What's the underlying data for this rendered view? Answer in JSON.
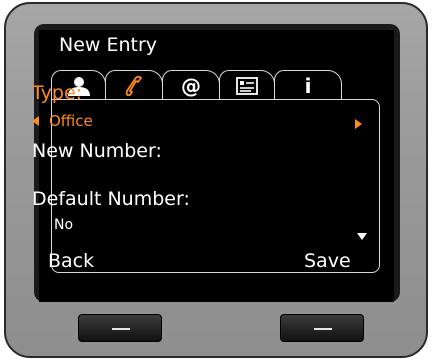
{
  "header": {
    "title": "New Entry"
  },
  "tabs": [
    {
      "icon": "person-icon",
      "selected": true
    },
    {
      "icon": "phone-handset-icon",
      "selected": false,
      "color": "#ff8a1e"
    },
    {
      "icon": "at-sign-icon",
      "label": "@"
    },
    {
      "icon": "contact-card-icon"
    },
    {
      "icon": "info-icon",
      "label": "i"
    }
  ],
  "form": {
    "type_label": "Type:",
    "type_value": "Office",
    "new_number_label": "New Number:",
    "default_number_label": "Default Number:",
    "default_number_value": "No"
  },
  "softkeys": {
    "left": "Back",
    "right": "Save"
  },
  "colors": {
    "accent": "#ff8a1e",
    "screen_bg": "#000000",
    "text": "#ffffff",
    "device": "#9a9a9a"
  }
}
